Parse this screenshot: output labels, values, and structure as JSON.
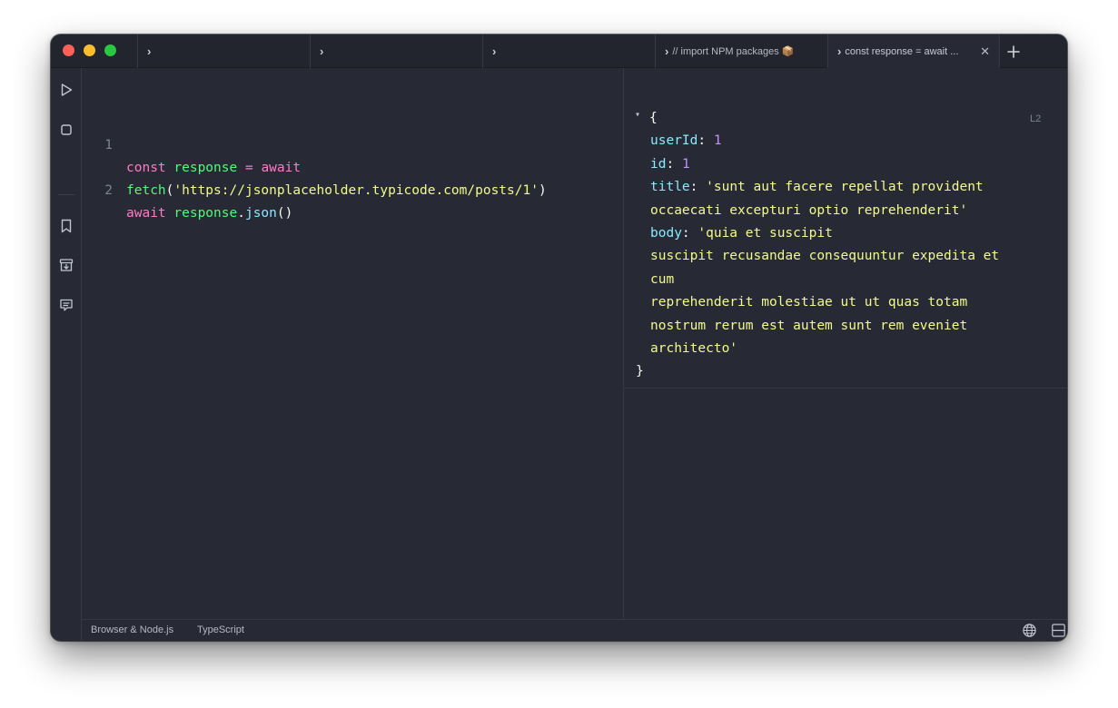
{
  "tabs": [
    {
      "label": ""
    },
    {
      "label": ""
    },
    {
      "label": ""
    },
    {
      "label": "// import NPM packages 📦"
    },
    {
      "label": "const response = await ...",
      "close": "✕"
    }
  ],
  "new_tab_label": "+",
  "sidebar": {
    "icons": [
      "play-icon",
      "stop-icon",
      "bookmark-icon",
      "archive-icon",
      "chat-icon",
      "gear-icon"
    ]
  },
  "editor": {
    "lines": [
      {
        "number": "1",
        "tokens": [
          {
            "t": "const",
            "c": "kw"
          },
          {
            "t": " ",
            "c": "pl"
          },
          {
            "t": "response",
            "c": "var"
          },
          {
            "t": " ",
            "c": "pl"
          },
          {
            "t": "=",
            "c": "kw"
          },
          {
            "t": " ",
            "c": "pl"
          },
          {
            "t": "await",
            "c": "kw"
          }
        ]
      },
      {
        "number": "",
        "tokens": [
          {
            "t": "fetch",
            "c": "var"
          },
          {
            "t": "(",
            "c": "pl"
          },
          {
            "t": "'https://jsonplaceholder.typicode.com/posts/1'",
            "c": "str"
          },
          {
            "t": ")",
            "c": "pl"
          }
        ]
      },
      {
        "number": "2",
        "tokens": [
          {
            "t": "await",
            "c": "kw"
          },
          {
            "t": " ",
            "c": "pl"
          },
          {
            "t": "response",
            "c": "var"
          },
          {
            "t": ".",
            "c": "pl"
          },
          {
            "t": "json",
            "c": "fn"
          },
          {
            "t": "()",
            "c": "pl"
          }
        ]
      }
    ]
  },
  "output": {
    "line_badge": "L2",
    "collapse_toggle": "▾",
    "lines": [
      {
        "indent": false,
        "tokens": [
          {
            "t": "{",
            "c": "pl"
          }
        ]
      },
      {
        "indent": true,
        "tokens": [
          {
            "t": "userId",
            "c": "okey"
          },
          {
            "t": ": ",
            "c": "pl"
          },
          {
            "t": "1",
            "c": "onum"
          }
        ]
      },
      {
        "indent": true,
        "tokens": [
          {
            "t": "id",
            "c": "okey"
          },
          {
            "t": ": ",
            "c": "pl"
          },
          {
            "t": "1",
            "c": "onum"
          }
        ]
      },
      {
        "indent": true,
        "tokens": [
          {
            "t": "title",
            "c": "okey"
          },
          {
            "t": ": ",
            "c": "pl"
          },
          {
            "t": "'sunt aut facere repellat provident",
            "c": "ostr"
          }
        ]
      },
      {
        "indent": true,
        "tokens": [
          {
            "t": "occaecati excepturi optio reprehenderit'",
            "c": "ostr"
          }
        ]
      },
      {
        "indent": true,
        "tokens": [
          {
            "t": "body",
            "c": "okey"
          },
          {
            "t": ": ",
            "c": "pl"
          },
          {
            "t": "'quia et suscipit",
            "c": "ostr"
          }
        ]
      },
      {
        "indent": true,
        "tokens": [
          {
            "t": "suscipit recusandae consequuntur expedita et",
            "c": "ostr"
          }
        ]
      },
      {
        "indent": true,
        "tokens": [
          {
            "t": "cum",
            "c": "ostr"
          }
        ]
      },
      {
        "indent": true,
        "tokens": [
          {
            "t": "reprehenderit molestiae ut ut quas totam",
            "c": "ostr"
          }
        ]
      },
      {
        "indent": true,
        "tokens": [
          {
            "t": "nostrum rerum est autem sunt rem eveniet",
            "c": "ostr"
          }
        ]
      },
      {
        "indent": true,
        "tokens": [
          {
            "t": "architecto'",
            "c": "ostr"
          }
        ]
      },
      {
        "indent": false,
        "tokens": [
          {
            "t": "}",
            "c": "pl"
          }
        ]
      }
    ]
  },
  "statusbar": {
    "environment": "Browser & Node.js",
    "language": "TypeScript"
  },
  "colors": {
    "background": "#272a35",
    "keyword": "#ff7ac6",
    "variable": "#50fa7b",
    "function": "#8be9fd",
    "string": "#f1fa8c",
    "number": "#bd93f9"
  }
}
